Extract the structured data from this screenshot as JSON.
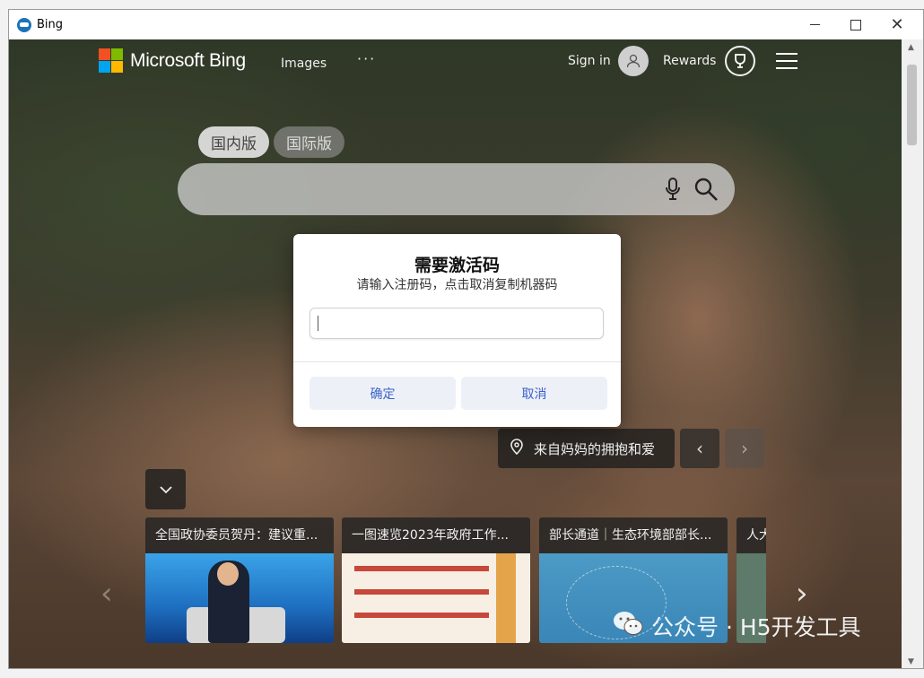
{
  "window": {
    "title": "Bing"
  },
  "header": {
    "brand": "Microsoft Bing",
    "nav_images": "Images",
    "nav_more": "···",
    "sign_in": "Sign in",
    "rewards": "Rewards"
  },
  "region_tabs": [
    {
      "label": "国内版",
      "active": true
    },
    {
      "label": "国际版",
      "active": false
    }
  ],
  "dialog": {
    "title": "需要激活码",
    "subtitle": "请输入注册码，点击取消复制机器码",
    "input_value": "",
    "ok_label": "确定",
    "cancel_label": "取消"
  },
  "image_info": {
    "location": "来自妈妈的拥抱和爱"
  },
  "news": [
    {
      "caption": "全国政协委员贺丹：建议重..."
    },
    {
      "caption": "一图速览2023年政府工作..."
    },
    {
      "caption": "部长通道｜生态环境部部长..."
    },
    {
      "caption": "人大"
    }
  ],
  "watermark": {
    "text": "公众号 · H5开发工具"
  },
  "colors": {
    "ms_red": "#f25022",
    "ms_green": "#7fba00",
    "ms_blue": "#00a4ef",
    "ms_yellow": "#ffb900",
    "accent": "#3a63c8"
  }
}
